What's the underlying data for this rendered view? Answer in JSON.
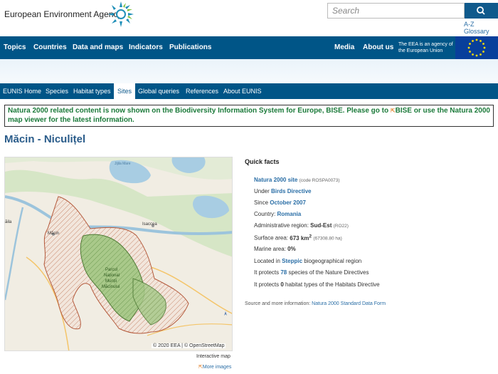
{
  "header": {
    "brand": "European Environment Agency",
    "search_placeholder": "Search",
    "az_glossary": "A-Z Glossary"
  },
  "main_nav": {
    "items": [
      "Topics",
      "Countries",
      "Data and maps",
      "Indicators",
      "Publications"
    ],
    "right_items": [
      "Media",
      "About us"
    ],
    "eu_note": "The EEA is an agency of the European Union"
  },
  "sub_nav": {
    "items": [
      "EUNIS Home",
      "Species",
      "Habitat types",
      "Sites",
      "Global queries",
      "References",
      "About EUNIS"
    ],
    "active": "Sites"
  },
  "notice": {
    "text_a": "Natura 2000 related content is now shown on the Biodiversity Information System for Europe, BISE. Please go to ",
    "text_b": "BISE or use the Natura 2000 map viewer for the latest information."
  },
  "page": {
    "title": "Măcin - Niculițel"
  },
  "map": {
    "labels": {
      "braila": "ăila",
      "macin": "Măcin",
      "isaccea": "Isaccea",
      "parcul": "Parcul",
      "national": "Național",
      "muntii": "Munții",
      "macin2": "Măcinului",
      "lake": "Jijila Mare"
    },
    "attribution": "© 2020 EEA | © OpenStreetMap",
    "caption": "Interactive map",
    "more_images": "More images"
  },
  "quick_facts": {
    "title": "Quick facts",
    "site_type": "Natura 2000 site",
    "code": "(code ROSPA0073)",
    "under_label": "Under",
    "directive": "Birds Directive",
    "since_label": "Since",
    "since": "October 2007",
    "country_label": "Country:",
    "country": "Romania",
    "region_label": "Administrative region:",
    "region": "Sud-Est",
    "region_code": "(RO22)",
    "surface_label": "Surface area:",
    "surface": "673 km",
    "surface_sup": "2",
    "surface_ha": "(67308.80 ha)",
    "marine_label": "Marine area:",
    "marine": "0%",
    "located_label": "Located in",
    "biogeo": "Steppic",
    "biogeo_suffix": "biogeographical region",
    "protects_label": "It protects",
    "species_count": "78",
    "species_suffix": "species of the Nature Directives",
    "habitat_count": "0",
    "habitat_suffix": "habitat types of the Habitats Directive",
    "source_label": "Source and more information:",
    "source_link": "Natura 2000 Standard Data Form"
  },
  "colors": {
    "nav_blue": "#005587",
    "title_blue": "#2a5c8a",
    "notice_green": "#1b7a3a"
  }
}
